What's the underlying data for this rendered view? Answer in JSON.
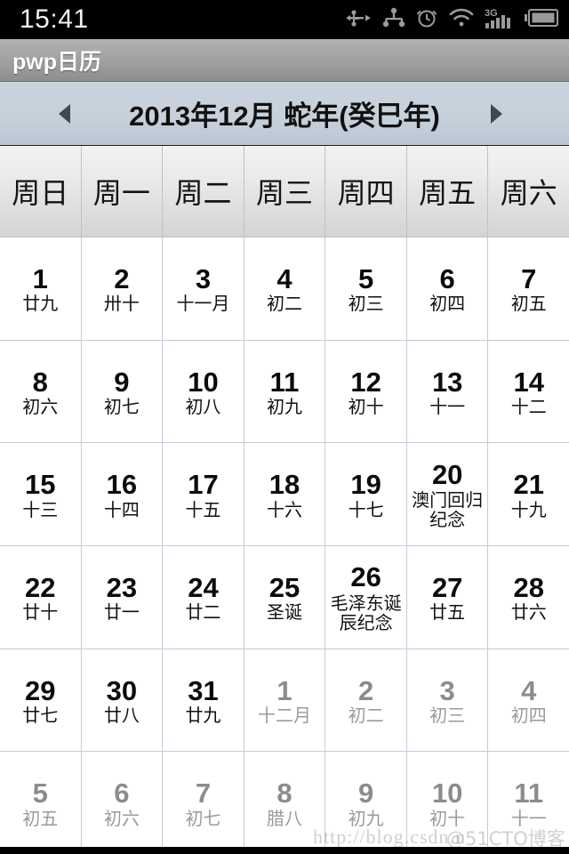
{
  "status_bar": {
    "clock": "15:41",
    "icons": [
      "usb-icon",
      "android-beam-icon",
      "alarm-clock-icon",
      "wifi-icon",
      "signal-3g-icon",
      "battery-icon"
    ],
    "signal_label": "3G",
    "background": "#000000"
  },
  "title_bar": {
    "title": "pwp日历",
    "background": "#a3a3a3"
  },
  "month_nav": {
    "prev_label": "◀",
    "next_label": "▶",
    "title": "2013年12月  蛇年(癸巳年)",
    "year": "2013",
    "month": "12",
    "zodiac": "蛇年(癸巳年)",
    "background": "#c7d1dc"
  },
  "weekdays": [
    "周日",
    "周一",
    "周二",
    "周三",
    "周四",
    "周五",
    "周六"
  ],
  "weeks": [
    [
      {
        "num": "1",
        "sub": "廿九",
        "other": false
      },
      {
        "num": "2",
        "sub": "卅十",
        "other": false
      },
      {
        "num": "3",
        "sub": "十一月",
        "other": false
      },
      {
        "num": "4",
        "sub": "初二",
        "other": false
      },
      {
        "num": "5",
        "sub": "初三",
        "other": false
      },
      {
        "num": "6",
        "sub": "初四",
        "other": false
      },
      {
        "num": "7",
        "sub": "初五",
        "other": false
      }
    ],
    [
      {
        "num": "8",
        "sub": "初六",
        "other": false
      },
      {
        "num": "9",
        "sub": "初七",
        "other": false
      },
      {
        "num": "10",
        "sub": "初八",
        "other": false
      },
      {
        "num": "11",
        "sub": "初九",
        "other": false
      },
      {
        "num": "12",
        "sub": "初十",
        "other": false
      },
      {
        "num": "13",
        "sub": "十一",
        "other": false
      },
      {
        "num": "14",
        "sub": "十二",
        "other": false
      }
    ],
    [
      {
        "num": "15",
        "sub": "十三",
        "other": false
      },
      {
        "num": "16",
        "sub": "十四",
        "other": false
      },
      {
        "num": "17",
        "sub": "十五",
        "other": false
      },
      {
        "num": "18",
        "sub": "十六",
        "other": false
      },
      {
        "num": "19",
        "sub": "十七",
        "other": false
      },
      {
        "num": "20",
        "sub": "澳门回归纪念",
        "other": false,
        "festival": true
      },
      {
        "num": "21",
        "sub": "十九",
        "other": false
      }
    ],
    [
      {
        "num": "22",
        "sub": "廿十",
        "other": false
      },
      {
        "num": "23",
        "sub": "廿一",
        "other": false
      },
      {
        "num": "24",
        "sub": "廿二",
        "other": false
      },
      {
        "num": "25",
        "sub": "圣诞",
        "other": false
      },
      {
        "num": "26",
        "sub": "毛泽东诞辰纪念",
        "other": false,
        "festival": true
      },
      {
        "num": "27",
        "sub": "廿五",
        "other": false
      },
      {
        "num": "28",
        "sub": "廿六",
        "other": false
      }
    ],
    [
      {
        "num": "29",
        "sub": "廿七",
        "other": false
      },
      {
        "num": "30",
        "sub": "廿八",
        "other": false
      },
      {
        "num": "31",
        "sub": "廿九",
        "other": false
      },
      {
        "num": "1",
        "sub": "十二月",
        "other": true
      },
      {
        "num": "2",
        "sub": "初二",
        "other": true
      },
      {
        "num": "3",
        "sub": "初三",
        "other": true
      },
      {
        "num": "4",
        "sub": "初四",
        "other": true
      }
    ],
    [
      {
        "num": "5",
        "sub": "初五",
        "other": true
      },
      {
        "num": "6",
        "sub": "初六",
        "other": true
      },
      {
        "num": "7",
        "sub": "初七",
        "other": true
      },
      {
        "num": "8",
        "sub": "腊八",
        "other": true
      },
      {
        "num": "9",
        "sub": "初九",
        "other": true
      },
      {
        "num": "10",
        "sub": "初十",
        "other": true
      },
      {
        "num": "11",
        "sub": "十一",
        "other": true
      }
    ]
  ],
  "watermark": {
    "url": "http://blog.csdn.n",
    "brand": "@51CTO博客"
  }
}
